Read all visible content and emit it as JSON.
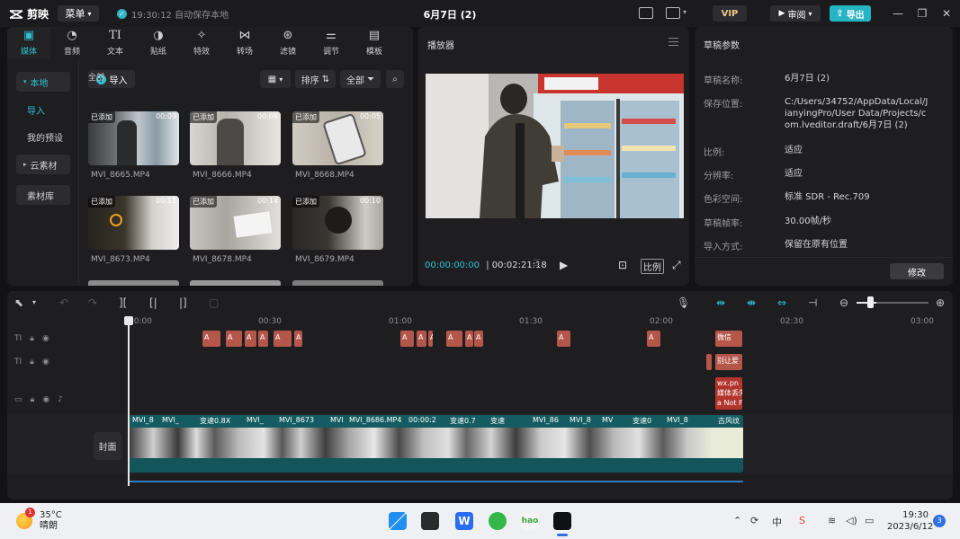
{
  "app": {
    "logo_text": "剪映",
    "menu_label": "菜单",
    "save_status": "19:30:12 自动保存本地",
    "doc_title": "6月7日 (2)",
    "vip_label": "VIP",
    "review_label": "审阅",
    "export_label": "导出"
  },
  "tools": [
    {
      "label": "媒体",
      "icon": "media-icon"
    },
    {
      "label": "音频",
      "icon": "audio-icon"
    },
    {
      "label": "文本",
      "icon": "text-icon"
    },
    {
      "label": "贴纸",
      "icon": "sticker-icon"
    },
    {
      "label": "特效",
      "icon": "effects-icon"
    },
    {
      "label": "转场",
      "icon": "transition-icon"
    },
    {
      "label": "滤镜",
      "icon": "filter-icon"
    },
    {
      "label": "调节",
      "icon": "adjust-icon"
    },
    {
      "label": "模板",
      "icon": "template-icon"
    }
  ],
  "sidebar": {
    "local": "本地",
    "import": "导入",
    "presets": "我的预设",
    "cloud": "云素材",
    "library": "素材库"
  },
  "media": {
    "import_label": "导入",
    "sort_label": "排序",
    "filter_label": "全部",
    "section_label": "全部",
    "added_tag": "已添加",
    "clips": [
      {
        "name": "MVI_8665.MP4",
        "dur": "00:09"
      },
      {
        "name": "MVI_8666.MP4",
        "dur": "00:08"
      },
      {
        "name": "MVI_8668.MP4",
        "dur": "00:05"
      },
      {
        "name": "MVI_8673.MP4",
        "dur": "00:11"
      },
      {
        "name": "MVI_8678.MP4",
        "dur": "00:14"
      },
      {
        "name": "MVI_8679.MP4",
        "dur": "00:10"
      }
    ]
  },
  "player": {
    "title": "播放器",
    "current_time": "00:00:00:00",
    "total_time": "00:02:21:18",
    "ratio_label": "比例"
  },
  "params": {
    "title": "草稿参数",
    "rows": [
      {
        "label": "草稿名称:",
        "value": "6月7日 (2)"
      },
      {
        "label": "保存位置:",
        "value": "C:/Users/34752/AppData/Local/JianyingPro/User Data/Projects/com.lveditor.draft/6月7日 (2)"
      },
      {
        "label": "比例:",
        "value": "适应"
      },
      {
        "label": "分辨率:",
        "value": "适应"
      },
      {
        "label": "色彩空间:",
        "value": "标准 SDR - Rec.709"
      },
      {
        "label": "草稿帧率:",
        "value": "30.00帧/秒"
      },
      {
        "label": "导入方式:",
        "value": "保留在原有位置"
      }
    ],
    "modify_label": "修改"
  },
  "timeline": {
    "ruler": [
      "00:00",
      "00:30",
      "01:00",
      "01:30",
      "02:00",
      "02:30",
      "03:00"
    ],
    "cover_label": "封面",
    "text_track1": [
      "A",
      "A",
      "A",
      "A",
      "A",
      "A",
      "A",
      "A",
      "A",
      "A",
      "A",
      "A",
      "A",
      "微信"
    ],
    "text_track2": "别让爱",
    "sticker_lines": [
      "wx.pn",
      "媒体丢失",
      "a Not F"
    ],
    "main_clips": [
      "MVI_8",
      "MVI_",
      "变速0.8X",
      "MVI_",
      "MVI_8673",
      "MVI",
      "MVI_8686.MP4",
      "00:00:2",
      "变速0.7",
      "变速",
      "MVI_86",
      "MVI_8",
      "MV",
      "变速0",
      "MVI_8",
      "古风纹"
    ]
  },
  "taskbar": {
    "temp": "35°C",
    "weather": "晴朗",
    "weather_badge": "1",
    "time": "19:30",
    "date": "2023/6/12",
    "notifications": "3"
  },
  "colors": {
    "accent": "#2fc1d2",
    "text_clip": "#b5564a",
    "main_track": "#145c61"
  }
}
